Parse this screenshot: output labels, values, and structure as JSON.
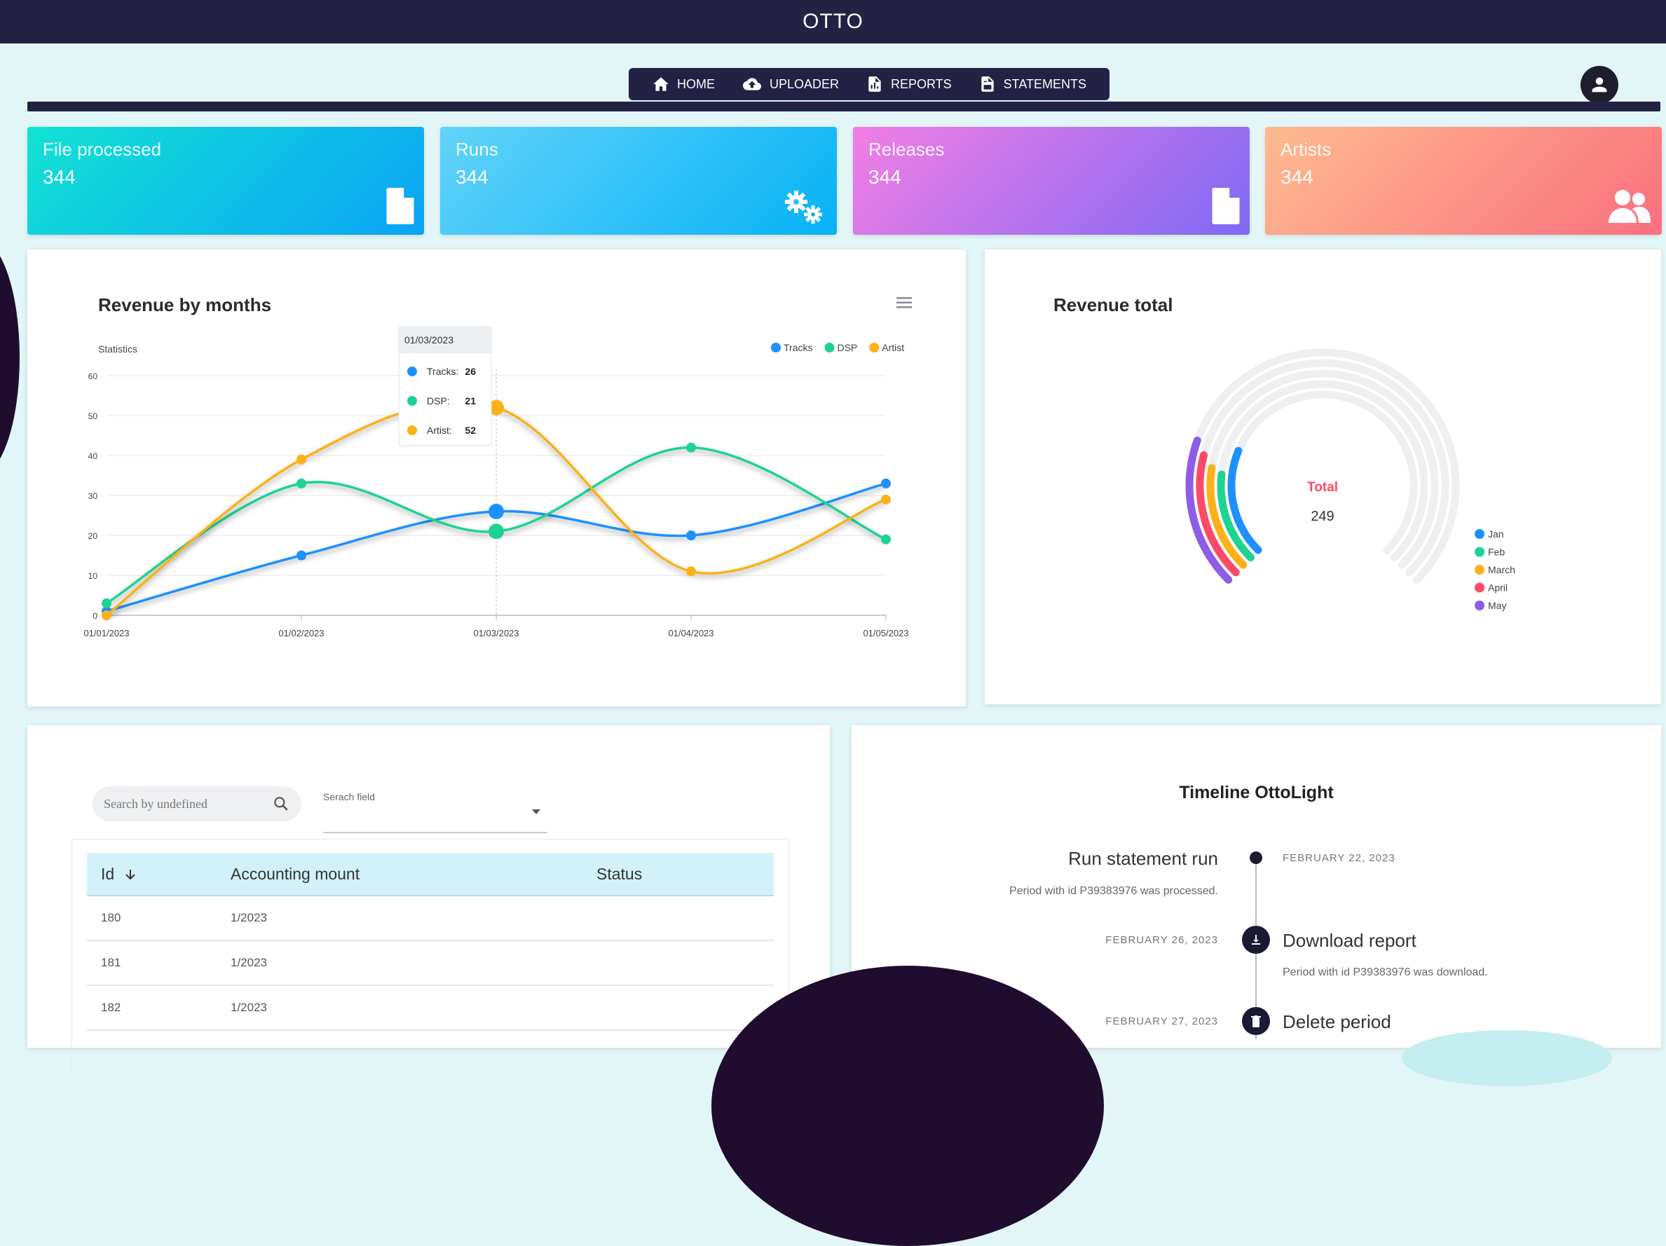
{
  "app": {
    "title": "OTTO"
  },
  "nav": [
    {
      "label": "HOME",
      "icon": "home-icon"
    },
    {
      "label": "UPLOADER",
      "icon": "cloud-upload-icon"
    },
    {
      "label": "REPORTS",
      "icon": "file-chart-icon"
    },
    {
      "label": "STATEMENTS",
      "icon": "file-invoice-icon"
    }
  ],
  "stats": [
    {
      "label": "File processed",
      "value": "344",
      "icon": "file-icon",
      "gradient": [
        "#13e2d3",
        "#0aa3f5"
      ]
    },
    {
      "label": "Runs",
      "value": "344",
      "icon": "gears-icon",
      "gradient": [
        "#62d3f8",
        "#06b2f6"
      ]
    },
    {
      "label": "Releases",
      "value": "344",
      "icon": "file-icon",
      "gradient": [
        "#f27fe3",
        "#7e69f5"
      ]
    },
    {
      "label": "Artists",
      "value": "344",
      "icon": "users-icon",
      "gradient": [
        "#fdbb8f",
        "#fa6f7f"
      ]
    }
  ],
  "revenue_months": {
    "title": "Revenue by months",
    "menu_icon": "hamburger-icon",
    "chart_data": {
      "type": "line",
      "ylabel": "Statistics",
      "ylim": [
        0,
        60
      ],
      "yticks": [
        0,
        10,
        20,
        30,
        40,
        50,
        60
      ],
      "categories": [
        "01/01/2023",
        "01/02/2023",
        "01/03/2023",
        "01/04/2023",
        "01/05/2023"
      ],
      "series": [
        {
          "name": "Tracks",
          "color": "#1e90ff",
          "values": [
            1,
            15,
            26,
            20,
            33
          ]
        },
        {
          "name": "DSP",
          "color": "#1ed391",
          "values": [
            3,
            33,
            21,
            42,
            19
          ]
        },
        {
          "name": "Artist",
          "color": "#fbb117",
          "values": [
            0,
            39,
            52,
            11,
            29
          ]
        }
      ],
      "legend": "top-right",
      "tooltip": {
        "title": "01/03/2023",
        "rows": [
          {
            "name": "Tracks",
            "value": "26",
            "color": "#1e90ff"
          },
          {
            "name": "DSP",
            "value": "21",
            "color": "#1ed391"
          },
          {
            "name": "Artist",
            "value": "52",
            "color": "#fbb117"
          }
        ]
      }
    }
  },
  "revenue_total": {
    "title": "Revenue total",
    "total_label": "Total",
    "total_value": "249",
    "chart_data": {
      "type": "radialBar",
      "categories": [
        "Jan",
        "Feb",
        "March",
        "April",
        "May"
      ],
      "values": [
        25,
        19,
        20,
        22,
        24
      ],
      "colors": [
        "#1e90ff",
        "#1ed391",
        "#fbb117",
        "#fc4a68",
        "#8e5ce6"
      ]
    }
  },
  "table": {
    "search_placeholder": "Search by undefined",
    "select_label": "Serach field",
    "columns": [
      "Id",
      "Accounting mount",
      "Status"
    ],
    "rows": [
      {
        "id": "180",
        "amount": "1/2023",
        "status": ""
      },
      {
        "id": "181",
        "amount": "1/2023",
        "status": ""
      },
      {
        "id": "182",
        "amount": "1/2023",
        "status": ""
      }
    ]
  },
  "timeline": {
    "title": "Timeline OttoLight",
    "events": [
      {
        "title": "Run statement run",
        "date": "FEBRUARY 22, 2023",
        "desc": "Period with id P39383976 was processed."
      },
      {
        "title": "Download report",
        "date": "FEBRUARY 26, 2023",
        "desc": "Period with id P39383976 was download."
      },
      {
        "title": "Delete period",
        "date": "FEBRUARY 27, 2023",
        "desc": ""
      }
    ]
  }
}
